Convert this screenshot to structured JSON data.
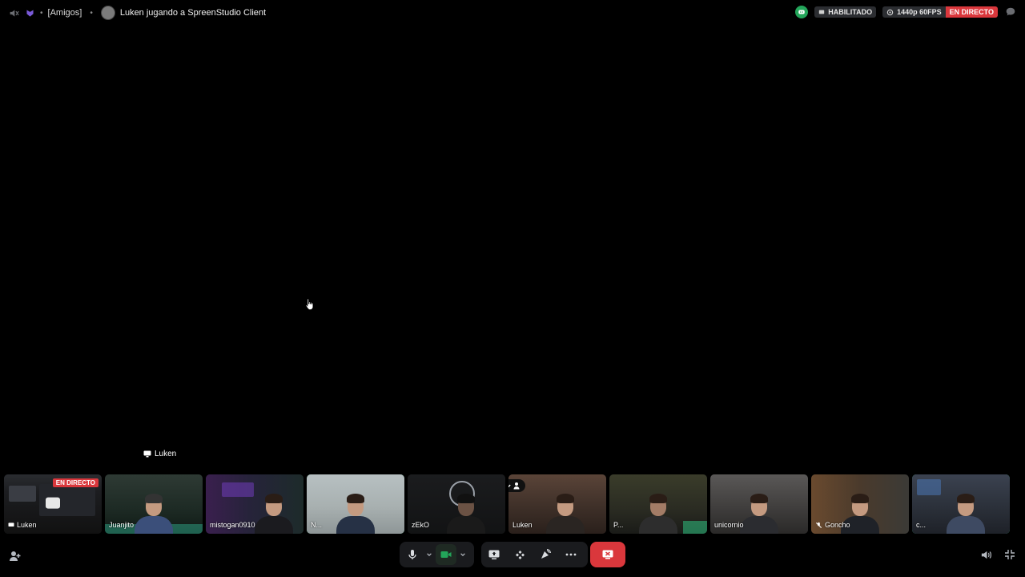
{
  "window": {
    "server_tag": "[Amigos]",
    "stream_title": "Luken jugando a SpreenStudio Client",
    "badges": {
      "enabled": "HABILITADO",
      "quality": "1440p 60FPS",
      "live": "EN DIRECTO"
    }
  },
  "stage": {
    "streamer_label": "Luken"
  },
  "tiles": [
    {
      "name": "Luken",
      "live": "EN DIRECTO",
      "type": "screen"
    },
    {
      "name": "Juanjito"
    },
    {
      "name": "mistogan0910"
    },
    {
      "name": "N..."
    },
    {
      "name": "zEkO"
    },
    {
      "name": "Luken"
    },
    {
      "name": "P..."
    },
    {
      "name": "unicornio"
    },
    {
      "name": "Goncho"
    },
    {
      "name": "c..."
    }
  ],
  "colors": {
    "accent_green": "#23a55a",
    "live_red": "#da373c",
    "speaking_border": "#2aa872",
    "control_bg": "#1a1b1e"
  },
  "icons": {
    "topbar": [
      "speaker-muted-icon",
      "channel-icon",
      "discord-icon",
      "broadcast-icon",
      "eye-icon",
      "chat-bubble-icon"
    ],
    "controls": [
      "microphone-icon",
      "camera-icon",
      "screen-share-icon",
      "activities-icon",
      "soundboard-icon",
      "more-icon",
      "leave-call-icon"
    ],
    "corner": [
      "invite-icon",
      "volume-icon",
      "exit-fullscreen-icon"
    ]
  }
}
